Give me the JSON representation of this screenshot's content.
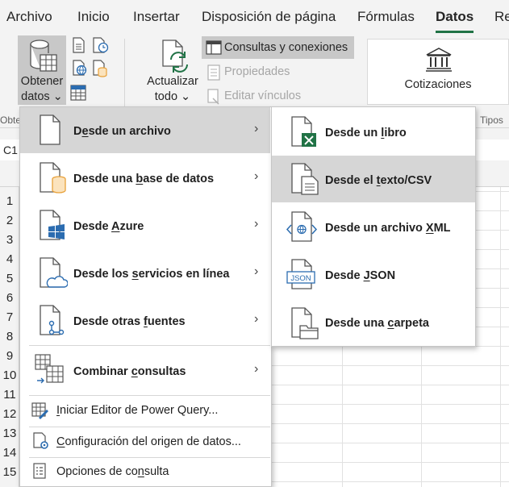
{
  "menu_bar": {
    "tabs": [
      "Archivo",
      "Inicio",
      "Insertar",
      "Disposición de página",
      "Fórmulas",
      "Datos",
      "Re"
    ],
    "active": "Datos"
  },
  "ribbon": {
    "get_data": {
      "line1": "Obtener",
      "line2": "datos"
    },
    "refresh": {
      "line1": "Actualizar",
      "line2": "todo"
    },
    "queries_connections": "Consultas y conexiones",
    "properties": "Propiedades",
    "edit_links": "Editar vínculos",
    "stocks": "Cotizaciones",
    "group_left": "Obte",
    "group_types": "Tipos"
  },
  "namebox": {
    "value": "C1"
  },
  "rows": [
    "1",
    "2",
    "3",
    "4",
    "5",
    "6",
    "7",
    "8",
    "9",
    "10",
    "11",
    "12",
    "13",
    "14",
    "15"
  ],
  "menu": {
    "items": [
      {
        "pre": "D",
        "ul": "e",
        "post": "sde un archivo"
      },
      {
        "pre": "Desde una ",
        "ul": "b",
        "post": "ase de datos"
      },
      {
        "pre": "Desde ",
        "ul": "A",
        "post": "zure"
      },
      {
        "pre": "Desde los ",
        "ul": "s",
        "post": "ervicios en línea"
      },
      {
        "pre": "Desde otras ",
        "ul": "f",
        "post": "uentes"
      },
      {
        "pre": "Combinar ",
        "ul": "c",
        "post": "onsultas"
      }
    ],
    "plain_items": [
      {
        "pre": "",
        "ul": "I",
        "post": "niciar Editor de Power Query..."
      },
      {
        "pre": "",
        "ul": "C",
        "post": "onfiguración del origen de datos..."
      },
      {
        "pre": "Opciones de co",
        "ul": "n",
        "post": "sulta"
      }
    ]
  },
  "submenu": {
    "items": [
      {
        "pre": "Desde un ",
        "ul": "l",
        "post": "ibro"
      },
      {
        "pre": "Desde el ",
        "ul": "t",
        "post": "exto/CSV"
      },
      {
        "pre": "Desde un archivo ",
        "ul": "X",
        "post": "ML"
      },
      {
        "pre": "Desde ",
        "ul": "J",
        "post": "SON"
      },
      {
        "pre": "Desde una ",
        "ul": "c",
        "post": "arpeta"
      }
    ],
    "icon_labels": {
      "json": "JSON"
    }
  },
  "colors": {
    "accent": "#217346",
    "blue": "#2b6cb0",
    "orange": "#e8a13a",
    "highlight": "#d6d6d6"
  }
}
